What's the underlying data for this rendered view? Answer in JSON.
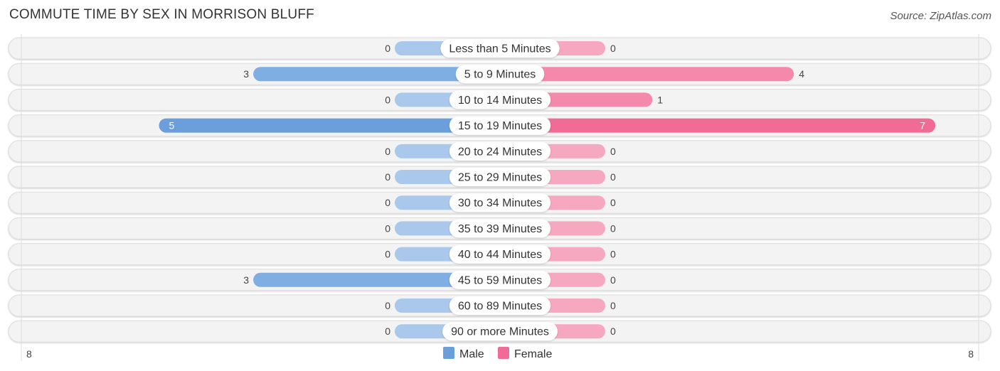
{
  "header": {
    "title": "COMMUTE TIME BY SEX IN MORRISON BLUFF",
    "source": "Source: ZipAtlas.com"
  },
  "colors": {
    "male": "#6a9fdc",
    "male_light": "#a9c8ec",
    "female": "#f06b95",
    "female_light": "#f6a8c1",
    "row_bg": "#f3f3f3"
  },
  "chart_data": {
    "type": "bar",
    "orientation": "horizontal-diverging",
    "title": "COMMUTE TIME BY SEX IN MORRISON BLUFF",
    "categories": [
      "Less than 5 Minutes",
      "5 to 9 Minutes",
      "10 to 14 Minutes",
      "15 to 19 Minutes",
      "20 to 24 Minutes",
      "25 to 29 Minutes",
      "30 to 34 Minutes",
      "35 to 39 Minutes",
      "40 to 44 Minutes",
      "45 to 59 Minutes",
      "60 to 89 Minutes",
      "90 or more Minutes"
    ],
    "series": [
      {
        "name": "Male",
        "values": [
          0,
          3,
          0,
          5,
          0,
          0,
          0,
          0,
          0,
          3,
          0,
          0
        ]
      },
      {
        "name": "Female",
        "values": [
          0,
          4,
          1,
          7,
          0,
          0,
          0,
          0,
          0,
          0,
          0,
          0
        ]
      }
    ],
    "axis": {
      "left_label": "8",
      "right_label": "8",
      "max": 8
    },
    "legend": {
      "position": "bottom-center",
      "entries": [
        "Male",
        "Female"
      ]
    }
  }
}
